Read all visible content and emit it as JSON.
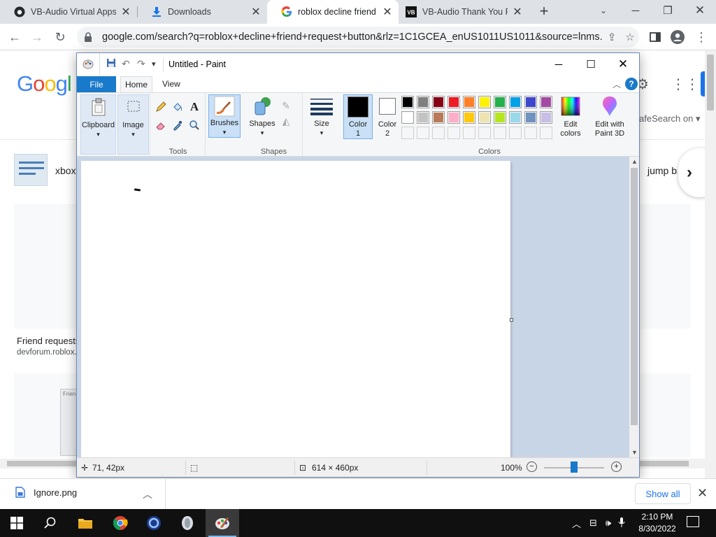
{
  "browser": {
    "tabs": [
      {
        "title": "VB-Audio Virtual Apps",
        "favicon": "github-icon",
        "active": false
      },
      {
        "title": "Downloads",
        "favicon": "download-icon",
        "active": false
      },
      {
        "title": "roblox decline friend re",
        "favicon": "google-icon",
        "active": true
      },
      {
        "title": "VB-Audio Thank You P",
        "favicon": "vb-icon",
        "active": false
      }
    ],
    "new_tab": "+",
    "url": "google.com/search?q=roblox+decline+friend+request+button&rlz=1C1GCEA_enUS1011US1011&source=lnms..."
  },
  "google": {
    "logo": "Googl",
    "safesearch": "afeSearch on",
    "chip_left": "xbox",
    "chip_right": "jump b",
    "result_title": "Friend requests",
    "result_url": "devforum.roblox.",
    "image_caption": "Frien"
  },
  "paint": {
    "title": "Untitled - Paint",
    "tabs": {
      "file": "File",
      "home": "Home",
      "view": "View"
    },
    "groups": {
      "clipboard": "Clipboard",
      "image": "Image",
      "tools": "Tools",
      "brushes": "Brushes",
      "shapes_btn": "Shapes",
      "shapes_group": "Shapes",
      "size": "Size",
      "color1_line1": "Color",
      "color1_line2": "1",
      "color2_line1": "Color",
      "color2_line2": "2",
      "edit_colors_line1": "Edit",
      "edit_colors_line2": "colors",
      "paint3d_line1": "Edit with",
      "paint3d_line2": "Paint 3D",
      "colors": "Colors"
    },
    "palette_row1": [
      "#000000",
      "#7f7f7f",
      "#880015",
      "#ed1c24",
      "#ff7f27",
      "#fff200",
      "#22b14c",
      "#00a2e8",
      "#3f48cc",
      "#a349a4"
    ],
    "palette_row2": [
      "#ffffff",
      "#c3c3c3",
      "#b97a57",
      "#ffaec9",
      "#ffc90e",
      "#efe4b0",
      "#b5e61d",
      "#99d9ea",
      "#7092be",
      "#c8bfe7"
    ],
    "color1": "#000000",
    "color2": "#ffffff",
    "status": {
      "cursor": "71, 42px",
      "size": "614 × 460px",
      "zoom": "100%",
      "zoom_level_fraction": 0.5
    }
  },
  "downloads": {
    "file": "Ignore.png",
    "show_all": "Show all"
  },
  "taskbar": {
    "time": "2:10 PM",
    "date": "8/30/2022"
  }
}
